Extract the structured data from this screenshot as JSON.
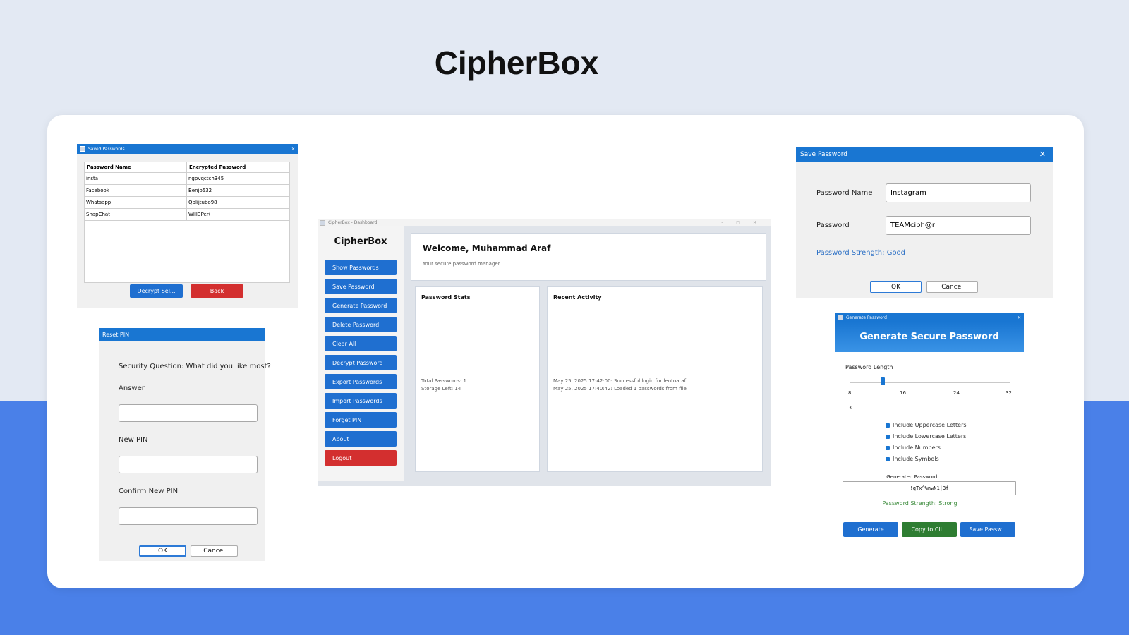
{
  "hero_title": "CipherBox",
  "saved_window": {
    "title": "Saved Passwords",
    "columns": [
      "Password Name",
      "Encrypted Password"
    ],
    "rows": [
      [
        "insta",
        "ngpvqctch345"
      ],
      [
        "Facebook",
        "Benjo532"
      ],
      [
        "Whatsapp",
        "Qblijtubo98"
      ],
      [
        "SnapChat",
        "WHDPer("
      ]
    ],
    "decrypt_label": "Decrypt Sel...",
    "back_label": "Back"
  },
  "reset_pin": {
    "title": "Reset PIN",
    "question": "Security Question: What did you like most?",
    "answer_label": "Answer",
    "new_pin_label": "New PIN",
    "confirm_label": "Confirm New PIN",
    "ok_label": "OK",
    "cancel_label": "Cancel"
  },
  "dashboard": {
    "window_title": "CipherBox - Dashboard",
    "brand": "CipherBox",
    "menu": [
      "Show Passwords",
      "Save Password",
      "Generate Password",
      "Delete Password",
      "Clear All",
      "Decrypt Password",
      "Export Passwords",
      "Import Passwords",
      "Forget PIN",
      "About",
      "Logout"
    ],
    "welcome": "Welcome, Muhammad Araf",
    "subtitle": "Your secure password manager",
    "stats_title": "Password Stats",
    "total_passwords": "Total Passwords: 1",
    "storage_left": "Storage Left: 14",
    "activity_title": "Recent Activity",
    "activity": [
      "May 25, 2025 17:42:00: Successful login for lentoaraf",
      "May 25, 2025 17:40:42: Loaded 1 passwords from file"
    ]
  },
  "save_password": {
    "title": "Save Password",
    "name_label": "Password Name",
    "name_value": "Instagram",
    "password_label": "Password",
    "password_value": "TEAMciph@r",
    "strength": "Password Strength: Good",
    "ok_label": "OK",
    "cancel_label": "Cancel"
  },
  "generate": {
    "window_title": "Generate Password",
    "header": "Generate Secure Password",
    "length_label": "Password Length",
    "ticks": [
      "8",
      "16",
      "24",
      "32"
    ],
    "length_value": "13",
    "slider_fraction": 0.208,
    "options": [
      "Include Uppercase Letters",
      "Include Lowercase Letters",
      "Include Numbers",
      "Include Symbols"
    ],
    "generated_label": "Generated Password:",
    "generated_value": "!qTx^%nwN1|3f",
    "strength": "Password Strength: Strong",
    "generate_btn": "Generate",
    "copy_btn": "Copy to Cli...",
    "save_btn": "Save Passw..."
  },
  "colors": {
    "accent_blue": "#1976d2",
    "danger_red": "#d32f2f",
    "success_green": "#2e7d32",
    "band_blue": "#4a80e8"
  }
}
